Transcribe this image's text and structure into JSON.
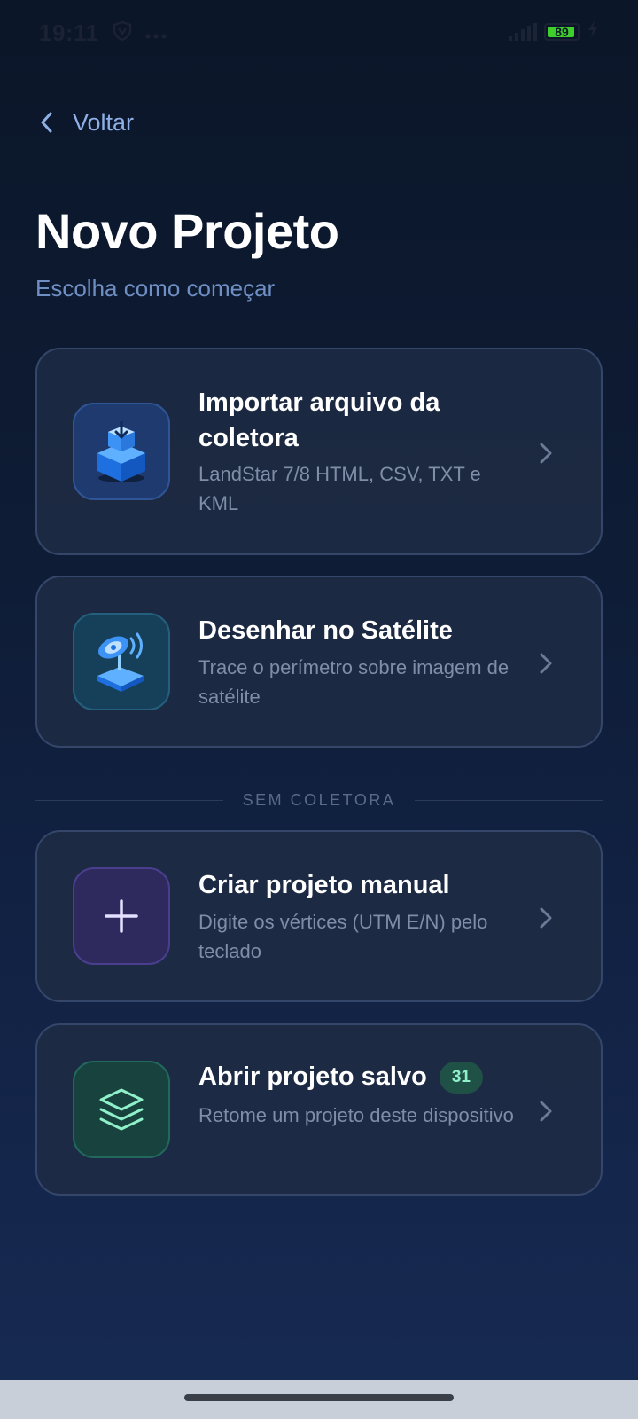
{
  "status": {
    "time": "19:11",
    "battery": "89"
  },
  "back_label": "Voltar",
  "title": "Novo Projeto",
  "subtitle": "Escolha como começar",
  "divider_label": "SEM COLETORA",
  "options": [
    {
      "title": "Importar arquivo da coletora",
      "description": "LandStar 7/8 HTML, CSV, TXT e KML",
      "icon": "import-box-icon"
    },
    {
      "title": "Desenhar no Satélite",
      "description": "Trace o perímetro sobre imagem de satélite",
      "icon": "satellite-dish-icon"
    },
    {
      "title": "Criar projeto manual",
      "description": "Digite os vértices (UTM E/N) pelo teclado",
      "icon": "plus-icon"
    },
    {
      "title": "Abrir projeto salvo",
      "description": "Retome um projeto deste dispositivo",
      "icon": "layers-icon",
      "badge": "31"
    }
  ],
  "colors": {
    "background": "#0e1c36",
    "card": "#1e2b44",
    "accent_blue": "#8fb0e6",
    "import_icon_bg": "#1e3a6e",
    "satellite_icon_bg": "#16405a",
    "manual_icon_bg": "#2e2a5e",
    "saved_icon_bg": "#17423d",
    "badge_bg": "#1f5147",
    "badge_text": "#8ff0c9"
  }
}
